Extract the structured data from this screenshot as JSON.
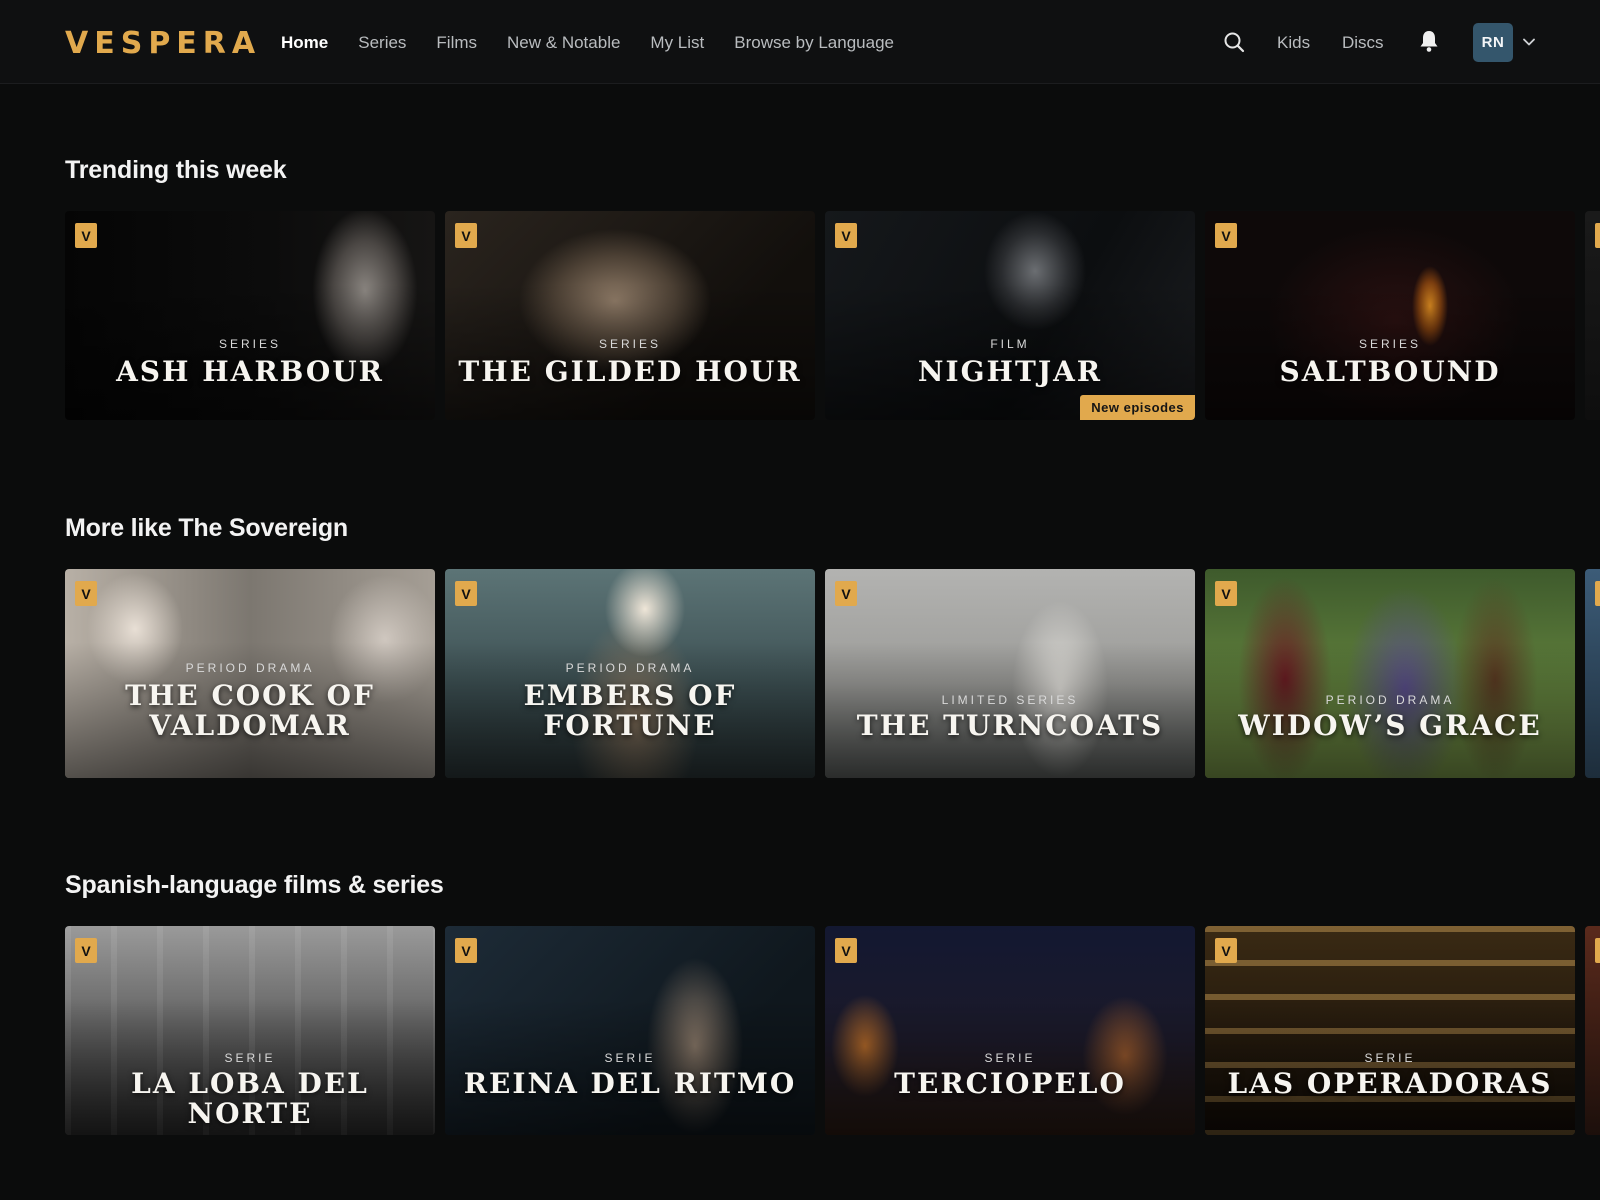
{
  "brand": {
    "logo": "VESPERA",
    "accent": "#e1a94d"
  },
  "nav": {
    "items": [
      "Home",
      "Series",
      "Films",
      "New & Notable",
      "My List",
      "Browse by Language"
    ],
    "active": "Home"
  },
  "header_right": {
    "search_icon": "search-icon",
    "links": [
      "Kids",
      "Discs"
    ],
    "bell_icon": "bell-icon",
    "avatar_initials": "RN",
    "avatar_color": "#34566c",
    "menu_icon": "chevron-down-icon"
  },
  "rows": [
    {
      "title": "Trending this week",
      "cards": [
        {
          "kind": "SERIES",
          "title": "ASH HARBOUR",
          "badge": "V"
        },
        {
          "kind": "SERIES",
          "title": "THE GILDED HOUR",
          "badge": "V"
        },
        {
          "kind": "FILM",
          "title": "NIGHTJAR",
          "badge": "V",
          "tag": "New episodes"
        },
        {
          "kind": "SERIES",
          "title": "SALTBOUND",
          "badge": "V"
        }
      ]
    },
    {
      "title": "More like The Sovereign",
      "cards": [
        {
          "kind": "PERIOD DRAMA",
          "title_lines": [
            "THE COOK OF",
            "VALDOMAR"
          ],
          "badge": "V"
        },
        {
          "kind": "PERIOD DRAMA",
          "title_lines": [
            "EMBERS OF",
            "FORTUNE"
          ],
          "badge": "V"
        },
        {
          "kind": "LIMITED SERIES",
          "title": "THE TURNCOATS",
          "badge": "V"
        },
        {
          "kind": "PERIOD DRAMA",
          "title": "WIDOW’S GRACE",
          "badge": "V"
        }
      ]
    },
    {
      "title": "Spanish-language films & series",
      "cards": [
        {
          "kind": "SERIE",
          "title": "LA LOBA DEL NORTE",
          "badge": "V"
        },
        {
          "kind": "SERIE",
          "title": "REINA DEL RITMO",
          "badge": "V"
        },
        {
          "kind": "SERIE",
          "title": "TERCIOPELO",
          "badge": "V"
        },
        {
          "kind": "SERIE",
          "title": "LAS OPERADORAS",
          "badge": "V"
        }
      ]
    }
  ]
}
